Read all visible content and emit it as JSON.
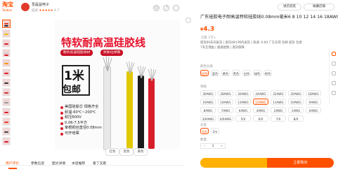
{
  "header": {
    "logo_cn": "淘宝",
    "logo_en": "Taobao",
    "shop_name": "圣磊益电子",
    "shop_rating_label": "描述",
    "shop_rating_stars": "★★★★★",
    "shop_rating_value": "4.7",
    "btn_shop": "进店逛逛",
    "btn_collect": "收藏店铺"
  },
  "gallery": {
    "banner_title": "特软耐高温硅胶线",
    "tags": [
      "耐负低温硅胶线材",
      "抗氧化绿铜"
    ],
    "big_label_1": "1米",
    "big_label_2": "包邮",
    "specs": [
      "美国硅胶芯 规格齐全",
      "耐温-60℃~200℃",
      "耐压600V",
      "0.06-7.5平方",
      "单根铜丝直径0.08mm",
      "可开增票"
    ],
    "color_tabs": [
      "红色",
      "黑色",
      "黄色"
    ]
  },
  "bottom_tabs": [
    "用户评价",
    "参数信息",
    "图文详情",
    "本店推荐",
    "看了又看"
  ],
  "product": {
    "title": "广东硅胶电子耐高温特软硅胶线0.08mm毫米6 8 10 12 14 16 18AWG",
    "price_symbol": "¥",
    "price": "4.3",
    "sub_price": "已售 1万+",
    "info_1": "现货60天内发货 | 退货48小时内发货 | 快递: 0.00 广东东莞 包邮 退货 包退",
    "info_2": "7天无理由 | 极速退款 | 退货保障",
    "section_color": "颜色分类",
    "colors": [
      "红色",
      "蓝色",
      "黄色",
      "黑色",
      "白色",
      "绿色",
      "棕色"
    ],
    "section_size": "线规",
    "sizes_row1": [
      "30AWG",
      "28AWG",
      "26AWG",
      "24AWG",
      "22AWG",
      "20AWG",
      "18AWG"
    ],
    "sizes_row2": [
      "16AWG",
      "14AWG",
      "13AWG",
      "12AWG",
      "11AWG",
      "10AWG",
      "9AWG"
    ],
    "sizes_row3": [
      "8AWG",
      "7AWG",
      "6AWG",
      "4AWG",
      "2AWG",
      "1AWG",
      "0AWG"
    ],
    "sizes_row4": [
      "3/0AWG",
      "4/0AWG",
      "5/0",
      "6/0",
      "7/0",
      "8/0"
    ],
    "section_len": "长度",
    "lengths": [
      "1m",
      "2m"
    ],
    "section_qty": "数量",
    "qty_value": "1",
    "btn_cart": "",
    "btn_buy": "立即购买"
  },
  "colors": {
    "accent": "#ff5000",
    "banner_red": "#e8102b"
  }
}
